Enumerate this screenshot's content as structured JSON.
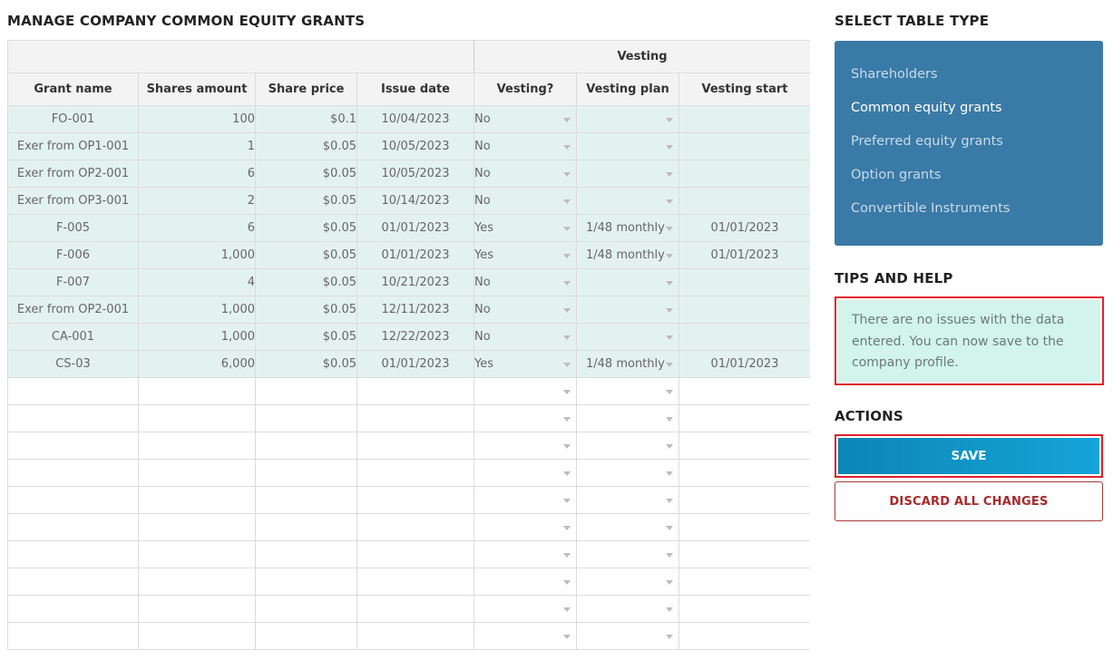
{
  "page_title": "MANAGE COMPANY COMMON EQUITY GRANTS",
  "table": {
    "group_header": "Vesting",
    "columns": [
      "Grant name",
      "Shares amount",
      "Share price",
      "Issue date",
      "Vesting?",
      "Vesting plan",
      "Vesting start"
    ],
    "rows": [
      {
        "name": "FO-001",
        "shares": "100",
        "price": "$0.1",
        "issue": "10/04/2023",
        "vesting": "No",
        "plan": "",
        "start": ""
      },
      {
        "name": "Exer from OP1-001",
        "shares": "1",
        "price": "$0.05",
        "issue": "10/05/2023",
        "vesting": "No",
        "plan": "",
        "start": ""
      },
      {
        "name": "Exer from OP2-001",
        "shares": "6",
        "price": "$0.05",
        "issue": "10/05/2023",
        "vesting": "No",
        "plan": "",
        "start": ""
      },
      {
        "name": "Exer from OP3-001",
        "shares": "2",
        "price": "$0.05",
        "issue": "10/14/2023",
        "vesting": "No",
        "plan": "",
        "start": ""
      },
      {
        "name": "F-005",
        "shares": "6",
        "price": "$0.05",
        "issue": "01/01/2023",
        "vesting": "Yes",
        "plan": "1/48 monthly",
        "start": "01/01/2023"
      },
      {
        "name": "F-006",
        "shares": "1,000",
        "price": "$0.05",
        "issue": "01/01/2023",
        "vesting": "Yes",
        "plan": "1/48 monthly",
        "start": "01/01/2023"
      },
      {
        "name": "F-007",
        "shares": "4",
        "price": "$0.05",
        "issue": "10/21/2023",
        "vesting": "No",
        "plan": "",
        "start": ""
      },
      {
        "name": "Exer from OP2-001",
        "shares": "1,000",
        "price": "$0.05",
        "issue": "12/11/2023",
        "vesting": "No",
        "plan": "",
        "start": ""
      },
      {
        "name": "CA-001",
        "shares": "1,000",
        "price": "$0.05",
        "issue": "12/22/2023",
        "vesting": "No",
        "plan": "",
        "start": ""
      },
      {
        "name": "CS-03",
        "shares": "6,000",
        "price": "$0.05",
        "issue": "01/01/2023",
        "vesting": "Yes",
        "plan": "1/48 monthly",
        "start": "01/01/2023"
      }
    ],
    "empty_row_count": 10
  },
  "table_type": {
    "heading": "SELECT TABLE TYPE",
    "items": [
      {
        "label": "Shareholders",
        "active": false
      },
      {
        "label": "Common equity grants",
        "active": true
      },
      {
        "label": "Preferred equity grants",
        "active": false
      },
      {
        "label": "Option grants",
        "active": false
      },
      {
        "label": "Convertible Instruments",
        "active": false
      }
    ],
    "bg_color": "#3a7aa7"
  },
  "tips": {
    "heading": "TIPS AND HELP",
    "text": "There are no issues with the data entered. You can now save to the company profile."
  },
  "actions": {
    "heading": "ACTIONS",
    "save_label": "SAVE",
    "discard_label": "DISCARD ALL CHANGES"
  },
  "colors": {
    "row_bg": "#e3f2ef",
    "tips_bg": "#d2f4ec",
    "highlight": "#e0202a",
    "save_bg": "#1197c7",
    "discard": "#a52b2b"
  }
}
